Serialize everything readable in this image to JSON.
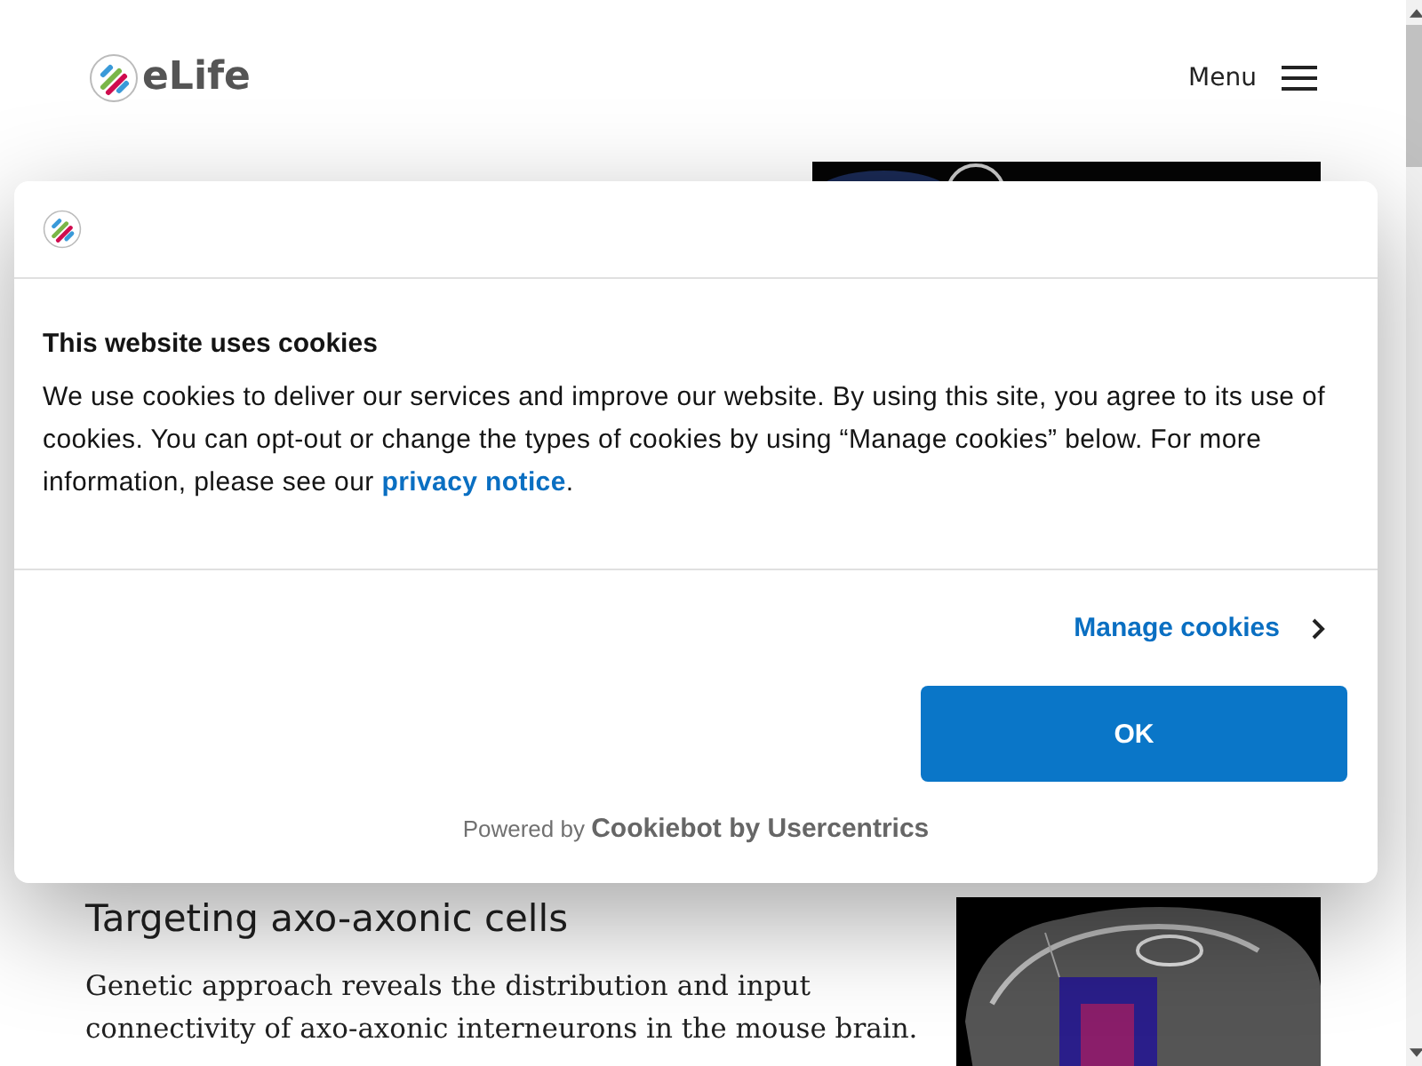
{
  "header": {
    "logo_text": "eLife",
    "menu_label": "Menu"
  },
  "article": {
    "title": "Targeting axo-axonic cells",
    "summary": "Genetic approach reveals the distribution and input connectivity of axo-axonic interneurons in the mouse brain."
  },
  "cookie_dialog": {
    "heading": "This website uses cookies",
    "body": "We use cookies to deliver our services and improve our website. By using this site, you agree to its use of cookies. You can opt-out or change the types of cookies by using “Manage cookies” below. For more information, please see our ",
    "link": "privacy notice",
    "body_end": ".",
    "manage_label": "Manage cookies",
    "ok_label": "OK",
    "powered_prefix": "Powered by",
    "powered_brand": "Cookiebot by Usercentrics"
  }
}
